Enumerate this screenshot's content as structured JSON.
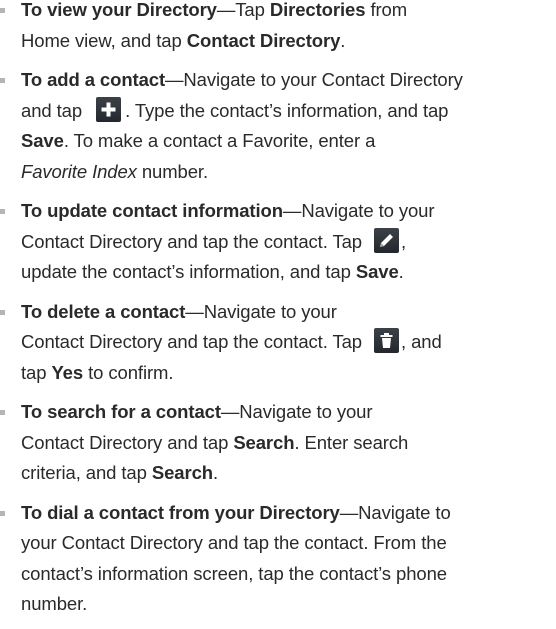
{
  "instructions": [
    {
      "lines": [
        [
          {
            "t": "To view your Directory",
            "b": true
          },
          {
            "t": "—Tap "
          },
          {
            "t": "Directories",
            "b": true
          },
          {
            "t": " from"
          }
        ],
        [
          {
            "t": "Home view, and tap "
          },
          {
            "t": "Contact Directory",
            "b": true
          },
          {
            "t": "."
          }
        ]
      ]
    },
    {
      "lines": [
        [
          {
            "t": "To add a contact",
            "b": true
          },
          {
            "t": "—Navigate to your Contact Directory"
          }
        ],
        [
          {
            "t": "and tap "
          },
          {
            "icon": "add-icon"
          },
          {
            "t": ". Type the contact’s information, and tap"
          }
        ],
        [
          {
            "t": "Save",
            "b": true
          },
          {
            "t": ". To make a contact a Favorite, enter a"
          }
        ],
        [
          {
            "t": "Favorite Index",
            "i": true
          },
          {
            "t": " number."
          }
        ]
      ]
    },
    {
      "lines": [
        [
          {
            "t": "To update contact information",
            "b": true
          },
          {
            "t": "—Navigate to your"
          }
        ],
        [
          {
            "t": "Contact Directory and tap the contact. Tap "
          },
          {
            "icon": "edit-icon"
          },
          {
            "t": ","
          }
        ],
        [
          {
            "t": "update the contact’s information, and tap "
          },
          {
            "t": "Save",
            "b": true
          },
          {
            "t": "."
          }
        ]
      ]
    },
    {
      "lines": [
        [
          {
            "t": "To delete a contact",
            "b": true
          },
          {
            "t": "—Navigate to your"
          }
        ],
        [
          {
            "t": "Contact Directory and tap the contact. Tap "
          },
          {
            "icon": "trash-icon"
          },
          {
            "t": ", and"
          }
        ],
        [
          {
            "t": "tap "
          },
          {
            "t": "Yes",
            "b": true
          },
          {
            "t": " to confirm."
          }
        ]
      ]
    },
    {
      "lines": [
        [
          {
            "t": "To search for a contact",
            "b": true
          },
          {
            "t": "—Navigate to your"
          }
        ],
        [
          {
            "t": "Contact Directory and tap "
          },
          {
            "t": "Search",
            "b": true
          },
          {
            "t": ". Enter search"
          }
        ],
        [
          {
            "t": "criteria, and tap "
          },
          {
            "t": "Search",
            "b": true
          },
          {
            "t": "."
          }
        ]
      ]
    },
    {
      "lines": [
        [
          {
            "t": "To dial a contact from your Directory",
            "b": true
          },
          {
            "t": "—Navigate to"
          }
        ],
        [
          {
            "t": "your Contact Directory and tap the contact. From the"
          }
        ],
        [
          {
            "t": "contact’s information screen, tap the contact’s phone"
          }
        ],
        [
          {
            "t": "number."
          }
        ]
      ]
    }
  ],
  "colors": {
    "text": "#2a2a2a",
    "bullet": "#b5b5b5",
    "icon_bg": "#23272d",
    "add_icon_glyph": "#ffffff",
    "edit_icon_glyph": "#ffffff",
    "trash_icon_glyph": "#ffffff"
  }
}
